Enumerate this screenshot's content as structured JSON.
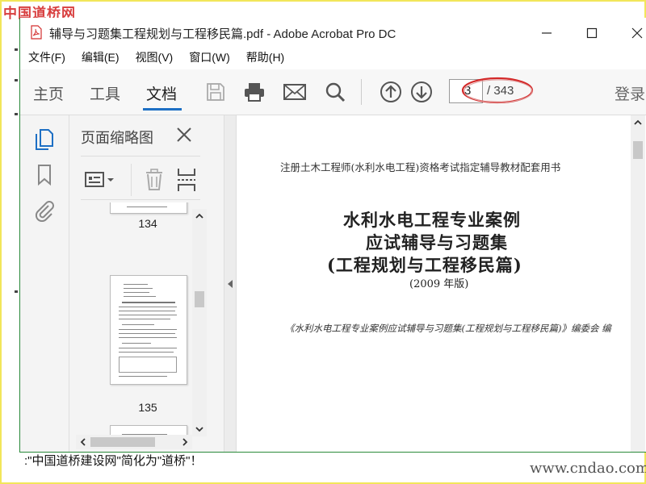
{
  "site_logo": "中国道桥网",
  "window": {
    "title": "辅导与习题集工程规划与工程移民篇.pdf - Adobe Acrobat Pro DC",
    "controls": [
      "minimize",
      "maximize",
      "close"
    ]
  },
  "menu": [
    "文件(F)",
    "编辑(E)",
    "视图(V)",
    "窗口(W)",
    "帮助(H)"
  ],
  "toolbar": {
    "tabs": [
      "主页",
      "工具",
      "文档"
    ],
    "active_tab": "文档",
    "current_page": "3",
    "total_pages": "/ 343",
    "login": "登录",
    "icons": [
      "save-icon",
      "print-icon",
      "email-icon",
      "search-icon",
      "page-up-icon",
      "page-down-icon"
    ]
  },
  "nav_icons": [
    "page-thumbnails-icon",
    "bookmarks-icon",
    "attachments-icon"
  ],
  "thumbnail_panel": {
    "title": "页面缩略图",
    "tools": [
      "thumbnail-options-icon",
      "delete-page-icon",
      "insert-page-icon"
    ],
    "page_labels": [
      "134",
      "135"
    ]
  },
  "document": {
    "series": "注册土木工程师(水利水电工程)资格考试指定辅导教材配套用书",
    "title_line1": "水利水电工程专业案例",
    "title_line2": "应试辅导与习题集",
    "title_line3": "(工程规划与工程移民篇)",
    "edition": "(2009 年版)",
    "committee": "《水利水电工程专业案例应试辅导与习题集(工程规划与工程移民篇)》编委会  编"
  },
  "bottom_caption": ":\"中国道桥建设网\"简化为\"道桥\"！",
  "watermark": "www.cndao.com",
  "colors": {
    "accent": "#1d6fc4",
    "highlight_oval": "#d42a2a",
    "frame": "#f2e65a",
    "pdf_icon": "#d32f2f"
  }
}
